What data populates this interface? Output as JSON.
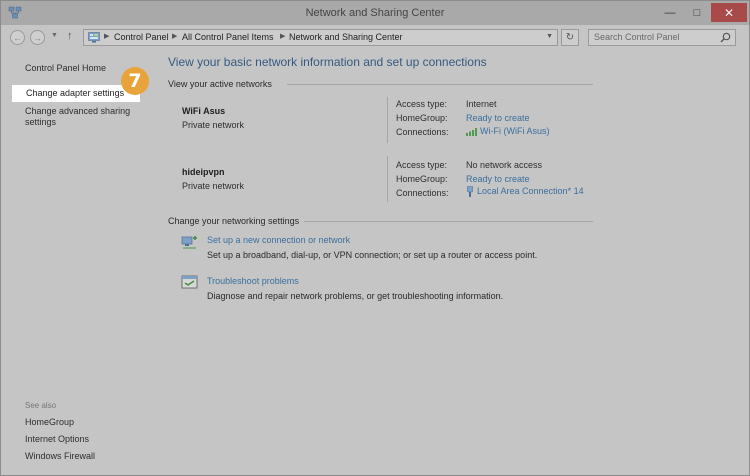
{
  "window": {
    "title": "Network and Sharing Center",
    "buttons": {
      "minimize": "—",
      "maximize": "□",
      "close": "✕"
    }
  },
  "address": {
    "crumbs": [
      "Control Panel",
      "All Control Panel Items",
      "Network and Sharing Center"
    ],
    "search_placeholder": "Search Control Panel"
  },
  "left": {
    "home": "Control Panel Home",
    "change_adapter": "Change adapter settings",
    "change_sharing_line1": "Change advanced sharing",
    "change_sharing_line2": "settings",
    "step_badge": "7",
    "see_also": "See also",
    "see_also_links": [
      "HomeGroup",
      "Internet Options",
      "Windows Firewall"
    ]
  },
  "main": {
    "heading": "View your basic network information and set up connections",
    "active_networks_label": "View your active networks",
    "networks": [
      {
        "name": "WiFi Asus",
        "type": "Private network",
        "access_type_label": "Access type:",
        "access_type": "Internet",
        "homegroup_label": "HomeGroup:",
        "homegroup": "Ready to create",
        "connections_label": "Connections:",
        "connection": "Wi-Fi (WiFi Asus)",
        "connection_icon": "wifi-signal-icon"
      },
      {
        "name": "hideipvpn",
        "type": "Private network",
        "access_type_label": "Access type:",
        "access_type": "No network access",
        "homegroup_label": "HomeGroup:",
        "homegroup": "Ready to create",
        "connections_label": "Connections:",
        "connection": "Local Area Connection* 14",
        "connection_icon": "vpn-plug-icon"
      }
    ],
    "change_settings_label": "Change your networking settings",
    "tasks": [
      {
        "link": "Set up a new connection or network",
        "desc": "Set up a broadband, dial-up, or VPN connection; or set up a router or access point.",
        "icon": "new-connection-icon"
      },
      {
        "link": "Troubleshoot problems",
        "desc": "Diagnose and repair network problems, or get troubleshooting information.",
        "icon": "troubleshoot-icon"
      }
    ]
  },
  "colors": {
    "link": "#3a6f9e",
    "heading": "#345a83",
    "badge": "#e8a33a",
    "close_button": "#a84a4a"
  }
}
